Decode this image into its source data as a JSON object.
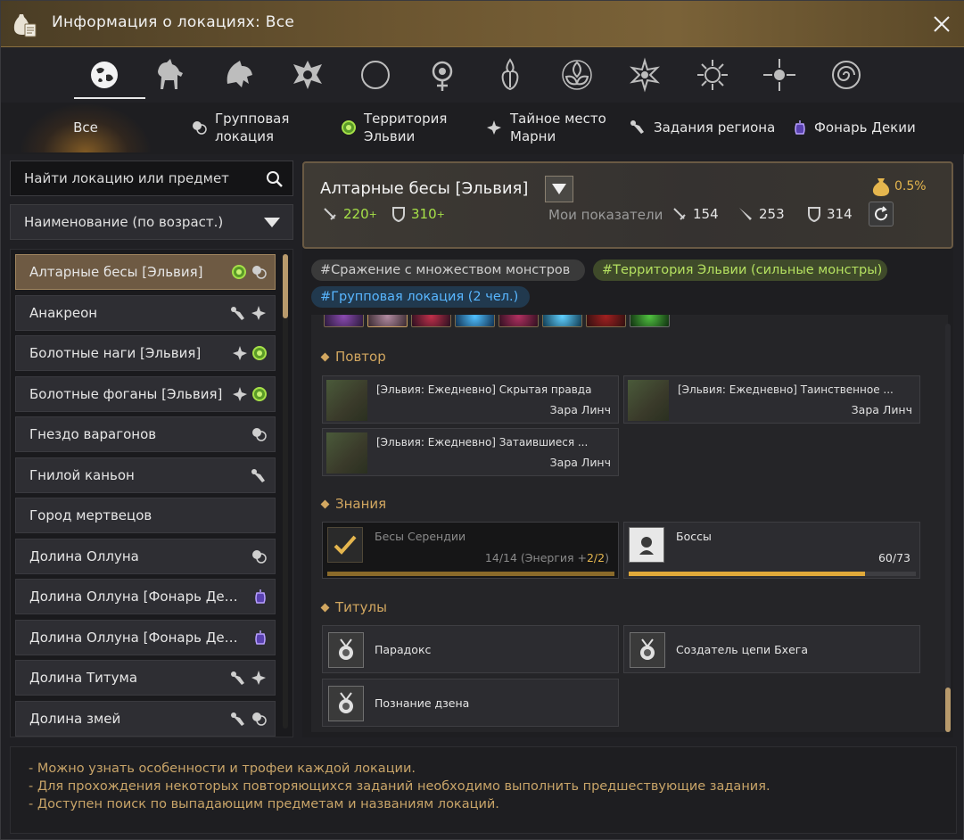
{
  "window": {
    "title": "Информация о локациях: Все"
  },
  "categories": [
    "globe-icon",
    "horse-icon",
    "beast-icon",
    "eagle-crest-icon",
    "moon-icon",
    "orb-emblem-icon",
    "flame-crest-icon",
    "lotus-emblem-icon",
    "star-emblem-icon",
    "sun-emblem-icon",
    "radiant-star-icon",
    "spiral-emblem-icon"
  ],
  "tabs": {
    "all": "Все",
    "group_line1": "Групповая",
    "group_line2": "локация",
    "territory_line1": "Территория",
    "territory_line2": "Эльвии",
    "secret_line1": "Тайное место",
    "secret_line2": "Марни",
    "quests": "Задания региона",
    "lantern": "Фонарь Декии"
  },
  "search": {
    "placeholder": "Найти локацию или предмет"
  },
  "sort": {
    "label": "Наименование (по возраст.)"
  },
  "locations": [
    {
      "name": "Алтарные бесы [Эльвия]",
      "icons": [
        "territory-icon",
        "group-icon"
      ]
    },
    {
      "name": "Анакреон",
      "icons": [
        "quest-icon",
        "secret-icon"
      ]
    },
    {
      "name": "Болотные наги [Эльвия]",
      "icons": [
        "secret-icon",
        "territory-icon"
      ]
    },
    {
      "name": "Болотные фоганы [Эльвия]",
      "icons": [
        "secret-icon",
        "territory-icon"
      ]
    },
    {
      "name": "Гнездо варагонов",
      "icons": [
        "group-icon"
      ]
    },
    {
      "name": "Гнилой каньон",
      "icons": [
        "quest-icon"
      ]
    },
    {
      "name": "Город мертвецов",
      "icons": []
    },
    {
      "name": "Долина Оллуна",
      "icons": [
        "group-icon"
      ]
    },
    {
      "name": "Долина Оллуна [Фонарь Декии]",
      "icons": [
        "lantern-icon"
      ]
    },
    {
      "name": "Долина Оллуна [Фонарь Декии]",
      "icons": [
        "lantern-icon"
      ]
    },
    {
      "name": "Долина Титума",
      "icons": [
        "quest-icon",
        "secret-icon"
      ]
    },
    {
      "name": "Долина змей",
      "icons": [
        "quest-icon",
        "group-icon"
      ]
    }
  ],
  "detail": {
    "name": "Алтарные бесы [Эльвия]",
    "ap": "220",
    "dp": "310",
    "plus": "+",
    "drop_rate": "0.5%",
    "my_stats_label": "Мои показатели",
    "my_ap": "154",
    "my_aap": "253",
    "my_dp": "314",
    "tags": [
      "#Сражение с множеством монстров",
      "#Территория Эльвии (сильные монстры)",
      "#Групповая локация (2 чел.)"
    ],
    "sections": {
      "repeat": "Повтор",
      "knowledge": "Знания",
      "titles": "Титулы"
    },
    "quests": [
      {
        "title": "[Эльвия: Ежедневно] Скрытая правда",
        "npc": "Зара Линч"
      },
      {
        "title": "[Эльвия: Ежедневно] Таинственное ...",
        "npc": "Зара Линч"
      },
      {
        "title": "[Эльвия: Ежедневно] Затаившиеся ...",
        "npc": "Зара Линч"
      }
    ],
    "knowledge": [
      {
        "name": "Бесы Серендии",
        "value_prefix": "14/14 (Энергия +",
        "value_accent": "2/2",
        "value_suffix": ")",
        "progress": 1.0
      },
      {
        "name": "Боссы",
        "value": "60/73",
        "progress": 0.822
      }
    ],
    "titles": [
      "Парадокс",
      "Создатель цепи Бхега",
      "Познание дзена"
    ]
  },
  "footer": [
    "- Можно узнать особенности и трофеи каждой локации.",
    "- Для прохождения некоторых повторяющихся заданий необходимо выполнить предшествующие задания.",
    "- Доступен поиск по выпадающим предметам и названиям локаций."
  ],
  "colors": {
    "accent": "#d2a760",
    "green": "#a6e048",
    "blue": "#58b6ff",
    "progress": "#e0a93a"
  }
}
